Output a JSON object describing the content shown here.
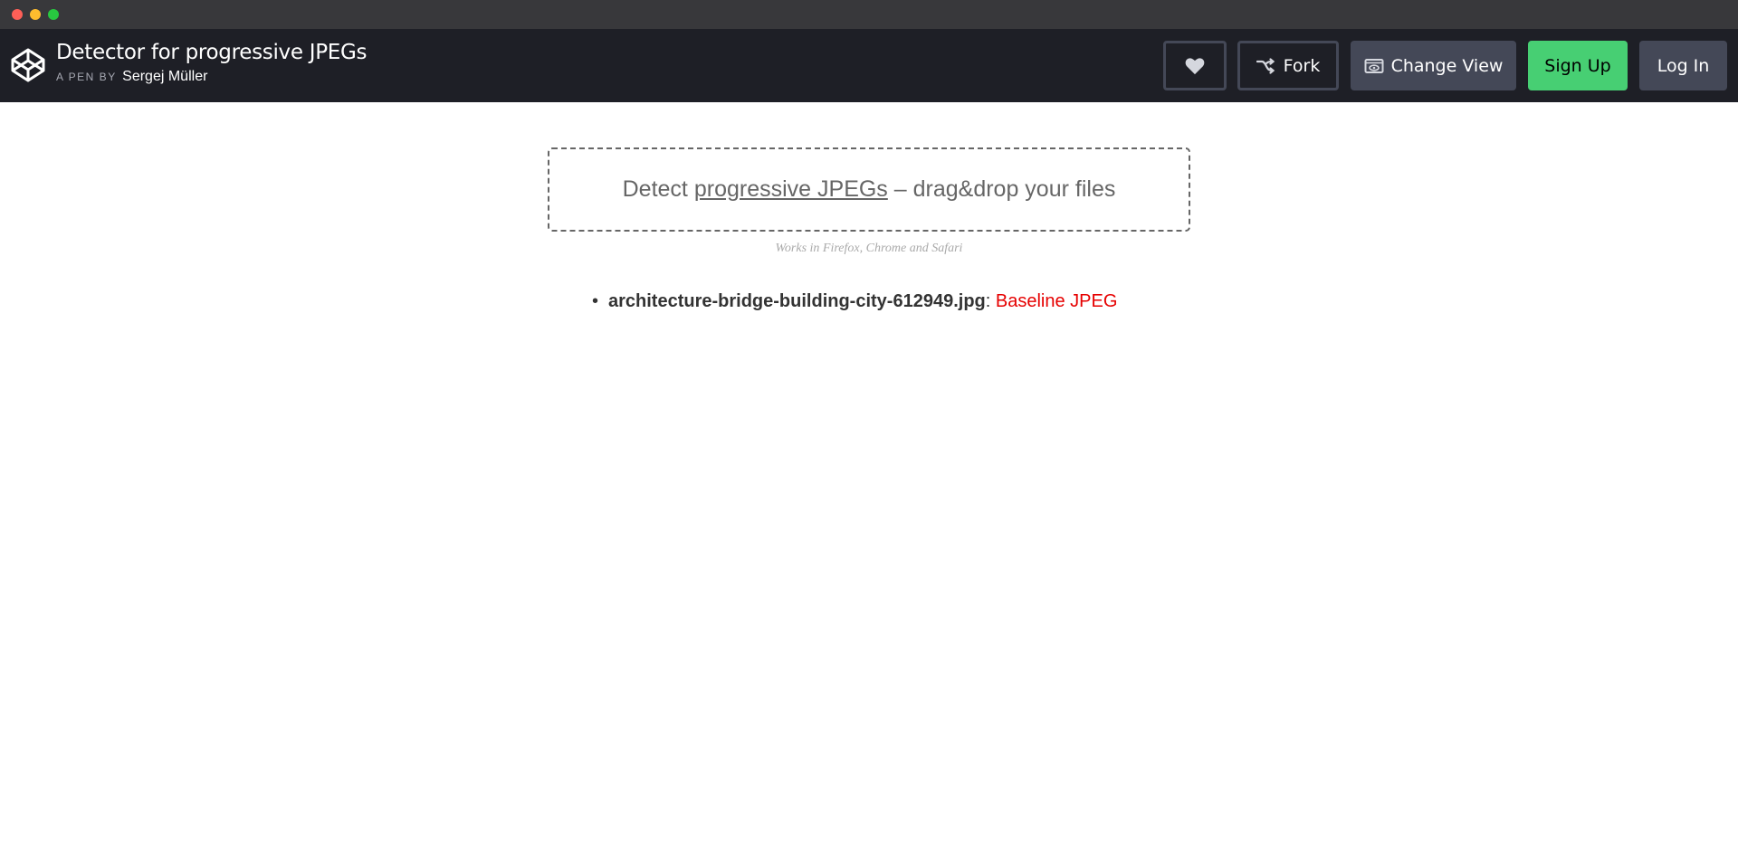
{
  "window": {
    "controls": [
      "close",
      "minimize",
      "maximize"
    ]
  },
  "header": {
    "logo_icon": "codepen-logo-icon",
    "title": "Detector for progressive JPEGs",
    "by_prefix": "A PEN BY",
    "author": "Sergej Müller",
    "buttons": {
      "heart_icon": "heart-icon",
      "fork_label": "Fork",
      "fork_icon": "fork-icon",
      "change_view_label": "Change View",
      "change_view_icon": "eye-window-icon",
      "signup_label": "Sign Up",
      "login_label": "Log In"
    }
  },
  "main": {
    "dropzone": {
      "prefix": "Detect ",
      "link_text": "progressive JPEGs",
      "suffix": " – drag&drop your files"
    },
    "note": "Works in Firefox, Chrome and Safari",
    "results": [
      {
        "filename": "architecture-bridge-building-city-612949.jpg",
        "separator": ": ",
        "status": "Baseline JPEG"
      }
    ]
  },
  "colors": {
    "titlebar": "#38383b",
    "header_bg": "#1e1f26",
    "button_gray": "#444857",
    "signup_green": "#47cf73",
    "status_red": "#e60000"
  }
}
